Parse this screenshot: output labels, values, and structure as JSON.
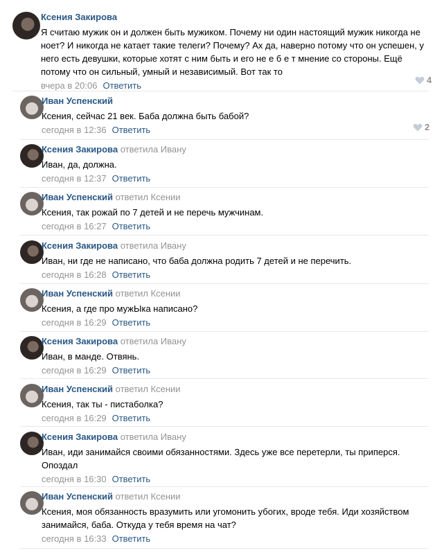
{
  "comments": [
    {
      "author": "Ксения Закирова",
      "reply_to": "",
      "text": "Я считаю мужик он и должен быть мужиком. Почему ни один настоящий мужик никогда не ноет? И никогда не катает такие телеги? Почему? Ах да, наверно потому что он успешен, у него есть девушки, которые хотят с ним быть и его не е б е т мнение со стороны. Ещё потому что он сильный, умный и независимый. Вот так то",
      "time": "вчера в 20:06",
      "reply_label": "Ответить",
      "likes": "4"
    },
    {
      "author": "Иван Успенский",
      "reply_to": "",
      "text": "Ксения, сейчас 21 век. Баба должна быть бабой?",
      "time": "сегодня в 12:36",
      "reply_label": "Ответить",
      "likes": "2"
    },
    {
      "author": "Ксения Закирова",
      "reply_to": "ответила Ивану",
      "text": "Иван, да, должна.",
      "time": "сегодня в 12:37",
      "reply_label": "Ответить",
      "likes": ""
    },
    {
      "author": "Иван Успенский",
      "reply_to": "ответил Ксении",
      "text": "Ксения, так рожай по 7 детей и не перечь мужчинам.",
      "time": "сегодня в 16:27",
      "reply_label": "Ответить",
      "likes": ""
    },
    {
      "author": "Ксения Закирова",
      "reply_to": "ответила Ивану",
      "text": "Иван, ни где не написано, что баба должна родить 7 детей и не перечить.",
      "time": "сегодня в 16:28",
      "reply_label": "Ответить",
      "likes": ""
    },
    {
      "author": "Иван Успенский",
      "reply_to": "ответил Ксении",
      "text": "Ксения, а где про мужЫка написано?",
      "time": "сегодня в 16:29",
      "reply_label": "Ответить",
      "likes": ""
    },
    {
      "author": "Ксения Закирова",
      "reply_to": "ответила Ивану",
      "text": "Иван, в манде. Отвянь.",
      "time": "сегодня в 16:29",
      "reply_label": "Ответить",
      "likes": ""
    },
    {
      "author": "Иван Успенский",
      "reply_to": "ответил Ксении",
      "text": "Ксения, так ты - пистаболка?",
      "time": "сегодня в 16:29",
      "reply_label": "Ответить",
      "likes": ""
    },
    {
      "author": "Ксения Закирова",
      "reply_to": "ответила Ивану",
      "text": "Иван, иди занимайся своими обязанностями. Здесь уже все перетерли, ты приперся. Опоздал",
      "time": "сегодня в 16:30",
      "reply_label": "Ответить",
      "likes": ""
    },
    {
      "author": "Иван Успенский",
      "reply_to": "ответил Ксении",
      "text": "Ксения, моя обязанность вразумить или угомонить убогих, вроде тебя. Иди хозяйством занимайся, баба. Откуда у тебя время на чат?",
      "time": "сегодня в 16:33",
      "reply_label": "Ответить",
      "likes": ""
    }
  ]
}
